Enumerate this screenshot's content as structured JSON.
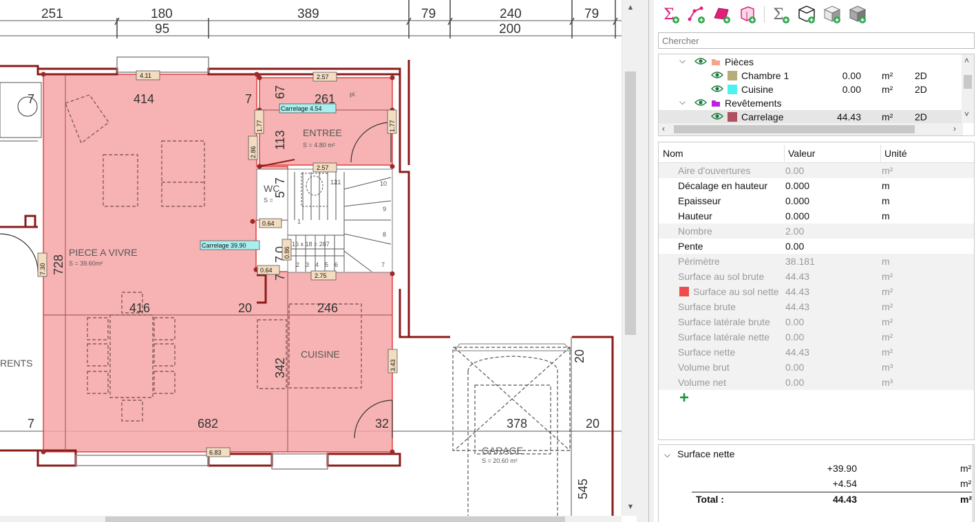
{
  "plan": {
    "top_dims_row1": [
      "251",
      "180",
      "389",
      "79",
      "240",
      "79"
    ],
    "top_dims_row2": [
      "95",
      "200"
    ],
    "rooms": {
      "piece_a_vivre": {
        "name": "PIECE A VIVRE",
        "area": "S = 39.60m²"
      },
      "entree": {
        "name": "ENTREE",
        "area": "S = 4.80 m²"
      },
      "wc": {
        "name": "WC",
        "area": "S ="
      },
      "cuisine": {
        "name": "CUISINE"
      },
      "garage": {
        "name": "GARAGE",
        "area": "S = 20.60 m²"
      },
      "parents": {
        "name": "RENTS"
      }
    },
    "inner_dims": [
      "414",
      "7",
      "67",
      "261",
      "113",
      "416",
      "20",
      "246",
      "342",
      "682",
      "32",
      "378",
      "20",
      "545",
      "728",
      "7",
      "7",
      "20",
      "7",
      "5",
      "7",
      "0",
      "7"
    ],
    "labels": {
      "carrelage_1": "Carrelage 4.54",
      "carrelage_2": "Carrelage 39.90",
      "l411": "4.11",
      "l257a": "2.57",
      "l257b": "2.57",
      "l177a": "1.77",
      "l177b": "1.77",
      "l286": "2.86",
      "l064a": "0.64",
      "l064b": "0.64",
      "l086": "0.86",
      "l275": "2.75",
      "l730": "7.30",
      "l343": "3.43",
      "l683": "6.83",
      "stairs": "16 x 18 = 287",
      "pl": "pl."
    },
    "stair_numbers": [
      "10",
      "9",
      "8",
      "7",
      "12",
      "11",
      "2",
      "3",
      "4",
      "5",
      "6",
      "1"
    ]
  },
  "toolbar": {
    "icons": [
      "sum-add-icon",
      "polyline-add-icon",
      "surface-add-icon",
      "room-add-icon",
      "sum-volume-icon",
      "box-add-icon",
      "box-shaded-add-icon",
      "box-gray-add-icon"
    ]
  },
  "search": {
    "placeholder": "Chercher"
  },
  "tree": {
    "rows": [
      {
        "expander": "⌵",
        "name": "Pièces",
        "color": "#f6a58a",
        "value": "",
        "unit": "",
        "mode": ""
      },
      {
        "expander": "",
        "name": "Chambre 1",
        "color": "#b5ad7a",
        "value": "0.00",
        "unit": "m²",
        "mode": "2D"
      },
      {
        "expander": "",
        "name": "Cuisine",
        "color": "#4ff0f0",
        "value": "0.00",
        "unit": "m²",
        "mode": "2D"
      },
      {
        "expander": "⌵",
        "name": "Revêtements",
        "color": "#c020e0",
        "value": "",
        "unit": "",
        "mode": ""
      },
      {
        "expander": "",
        "name": "Carrelage",
        "color": "#b05060",
        "value": "44.43",
        "unit": "m²",
        "mode": "2D"
      }
    ]
  },
  "props": {
    "headers": {
      "name": "Nom",
      "value": "Valeur",
      "unit": "Unité"
    },
    "rows": [
      {
        "name": "Aire d'ouvertures",
        "value": "0.00",
        "unit": "m²",
        "enabled": false
      },
      {
        "name": "Décalage en hauteur",
        "value": "0.000",
        "unit": "m",
        "enabled": true
      },
      {
        "name": "Epaisseur",
        "value": "0.000",
        "unit": "m",
        "enabled": true
      },
      {
        "name": "Hauteur",
        "value": "0.000",
        "unit": "m",
        "enabled": true
      },
      {
        "name": "Nombre",
        "value": "2.00",
        "unit": "",
        "enabled": false
      },
      {
        "name": "Pente",
        "value": "0.00",
        "unit": "",
        "enabled": true
      },
      {
        "name": "Périmètre",
        "value": "38.181",
        "unit": "m",
        "enabled": false
      },
      {
        "name": "Surface au sol brute",
        "value": "44.43",
        "unit": "m²",
        "enabled": false
      },
      {
        "name": "Surface au sol nette",
        "value": "44.43",
        "unit": "m²",
        "enabled": false
      },
      {
        "name": "Surface brute",
        "value": "44.43",
        "unit": "m²",
        "enabled": false
      },
      {
        "name": "Surface latérale brute",
        "value": "0.00",
        "unit": "m²",
        "enabled": false
      },
      {
        "name": "Surface latérale nette",
        "value": "0.00",
        "unit": "m²",
        "enabled": false
      },
      {
        "name": "Surface nette",
        "value": "44.43",
        "unit": "m²",
        "enabled": false
      },
      {
        "name": "Volume brut",
        "value": "0.00",
        "unit": "m³",
        "enabled": false
      },
      {
        "name": "Volume net",
        "value": "0.00",
        "unit": "m³",
        "enabled": false
      }
    ],
    "add_label": "+"
  },
  "summary": {
    "title": "Surface nette",
    "lines": [
      {
        "value": "+39.90",
        "unit": "m²"
      },
      {
        "value": "+4.54",
        "unit": "m²"
      }
    ],
    "total_label": "Total :",
    "total_value": "44.43",
    "total_unit": "m²"
  }
}
